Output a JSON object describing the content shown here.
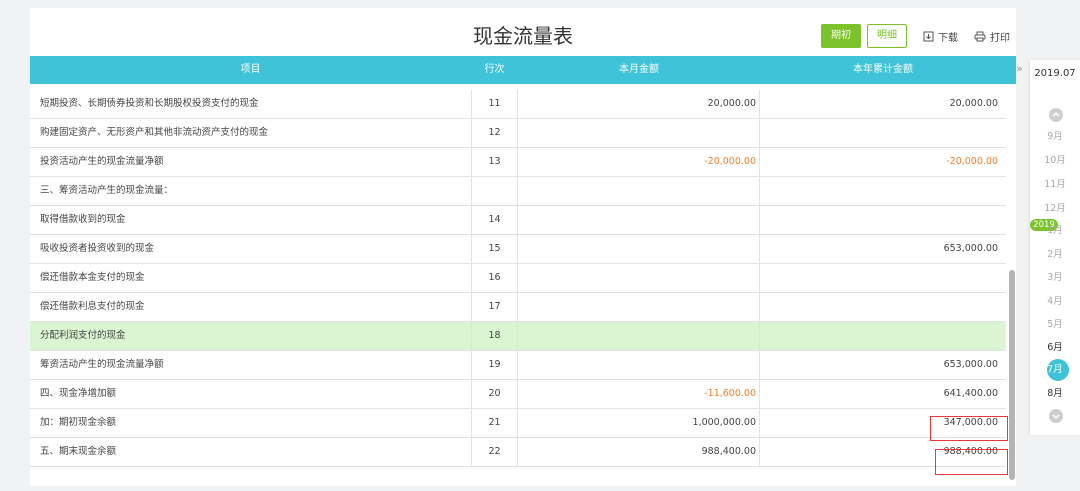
{
  "title": "现金流量表",
  "toolbar": {
    "btn_initial": "期初",
    "btn_detail": "明细",
    "download": "下载",
    "print": "打印"
  },
  "columns": {
    "item": "项目",
    "line": "行次",
    "month_amount": "本月金额",
    "year_amount": "本年累计金额"
  },
  "rows": [
    {
      "name": "短期投资、长期债券投资和长期股权投资支付的现金",
      "line": "11",
      "month": "20,000.00",
      "year": "20,000.00"
    },
    {
      "name": "购建固定资产、无形资产和其他非流动资产支付的现金",
      "line": "12",
      "month": "",
      "year": ""
    },
    {
      "name": "投资活动产生的现金流量净额",
      "line": "13",
      "month": "-20,000.00",
      "year": "-20,000.00"
    },
    {
      "name": "三、筹资活动产生的现金流量：",
      "line": "",
      "month": "",
      "year": ""
    },
    {
      "name": "取得借款收到的现金",
      "line": "14",
      "month": "",
      "year": ""
    },
    {
      "name": "吸收投资者投资收到的现金",
      "line": "15",
      "month": "",
      "year": "653,000.00"
    },
    {
      "name": "偿还借款本金支付的现金",
      "line": "16",
      "month": "",
      "year": ""
    },
    {
      "name": "偿还借款利息支付的现金",
      "line": "17",
      "month": "",
      "year": ""
    },
    {
      "name": "分配利润支付的现金",
      "line": "18",
      "month": "",
      "year": ""
    },
    {
      "name": "筹资活动产生的现金流量净额",
      "line": "19",
      "month": "",
      "year": "653,000.00"
    },
    {
      "name": "四、现金净增加额",
      "line": "20",
      "month": "-11,600.00",
      "year": "641,400.00"
    },
    {
      "name": "加：期初现金余额",
      "line": "21",
      "month": "1,000,000.00",
      "year": "347,000.00"
    },
    {
      "name": "五、期末现金余额",
      "line": "22",
      "month": "988,400.00",
      "year": "988,400.00"
    }
  ],
  "sidebar": {
    "current_period": "2019.07",
    "prev_months": [
      "9月",
      "10月",
      "11月",
      "12月"
    ],
    "year_badge": "2019",
    "months": [
      "1月",
      "2月",
      "3月",
      "4月",
      "5月",
      "6月",
      "7月",
      "8月"
    ],
    "active_month": "7月"
  },
  "colors": {
    "header": "#3ec3d8",
    "accent_green": "#7cc22a",
    "negative": "#f0812a",
    "highlight_row": "#dbf5d2",
    "annotation_red": "#e5383b"
  }
}
